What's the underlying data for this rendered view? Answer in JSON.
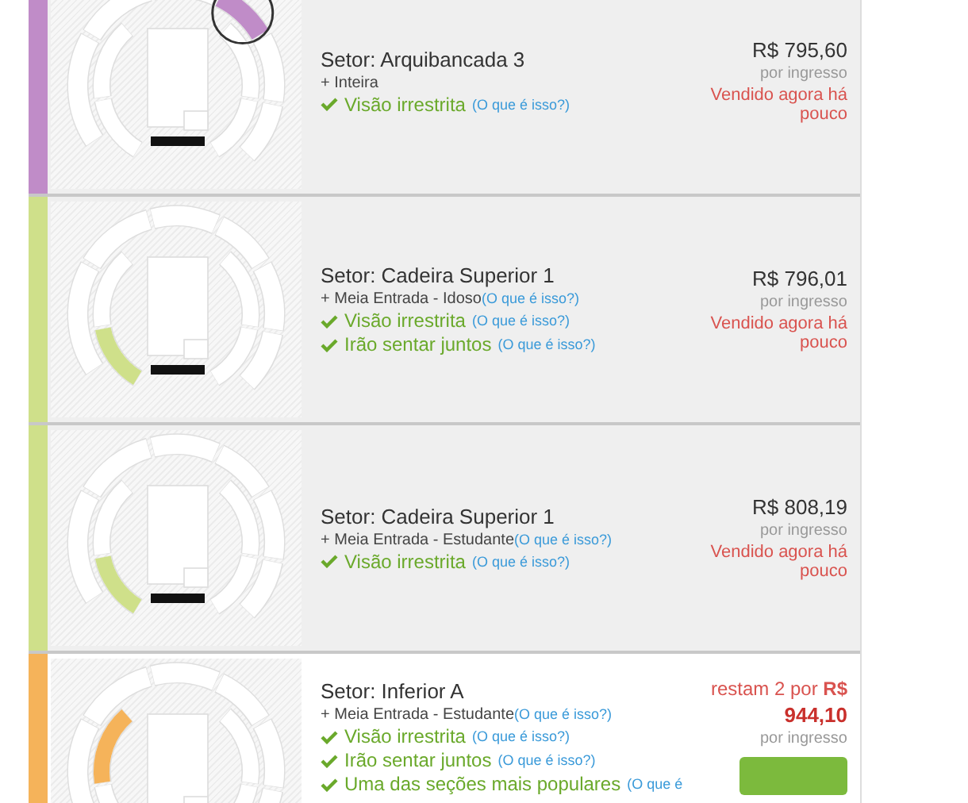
{
  "listings": [
    {
      "color": "#c08cc8",
      "highlighted": false,
      "kind": "outer",
      "magnifier": true,
      "title": "Setor: Arquibancada 3",
      "fare": {
        "text": "+ Inteira"
      },
      "features": [
        {
          "text": "Visão irrestrita",
          "link": "(O que é isso?)"
        }
      ],
      "price": {
        "kind": "sold",
        "amount": "R$ 795,60",
        "unit": "por ingresso",
        "note": "Vendido agora há pouco"
      }
    },
    {
      "color": "#cfe08a",
      "highlighted": false,
      "kind": "side",
      "magnifier": false,
      "title": "Setor: Cadeira Superior 1",
      "fare": {
        "text": "+ Meia Entrada - Idoso",
        "link": "(O que é isso?)"
      },
      "features": [
        {
          "text": "Visão irrestrita",
          "link": "(O que é isso?)"
        },
        {
          "text": "Irão sentar juntos",
          "link": "(O que é isso?)"
        }
      ],
      "price": {
        "kind": "sold",
        "amount": "R$ 796,01",
        "unit": "por ingresso",
        "note": "Vendido agora há pouco"
      }
    },
    {
      "color": "#cfe08a",
      "highlighted": false,
      "kind": "side",
      "magnifier": false,
      "title": "Setor: Cadeira Superior 1",
      "fare": {
        "text": "+ Meia Entrada - Estudante",
        "link": "(O que é isso?)"
      },
      "features": [
        {
          "text": "Visão irrestrita",
          "link": "(O que é isso?)"
        }
      ],
      "price": {
        "kind": "sold",
        "amount": "R$ 808,19",
        "unit": "por ingresso",
        "note": "Vendido agora há pouco"
      }
    },
    {
      "color": "#f5b35a",
      "highlighted": true,
      "kind": "corner",
      "magnifier": false,
      "title": "Setor: Inferior A",
      "fare": {
        "text": "+ Meia Entrada - Estudante",
        "link": "(O que é isso?)"
      },
      "features": [
        {
          "text": "Visão irrestrita",
          "link": "(O que é isso?)"
        },
        {
          "text": "Irão sentar juntos",
          "link": "(O que é isso?)"
        },
        {
          "text": "Uma das seções mais populares",
          "link": "(O que é"
        }
      ],
      "price": {
        "kind": "remaining",
        "note": "restam 2 por **R$**",
        "amount": "944,10",
        "unit": "por ingresso",
        "button": true
      }
    }
  ]
}
